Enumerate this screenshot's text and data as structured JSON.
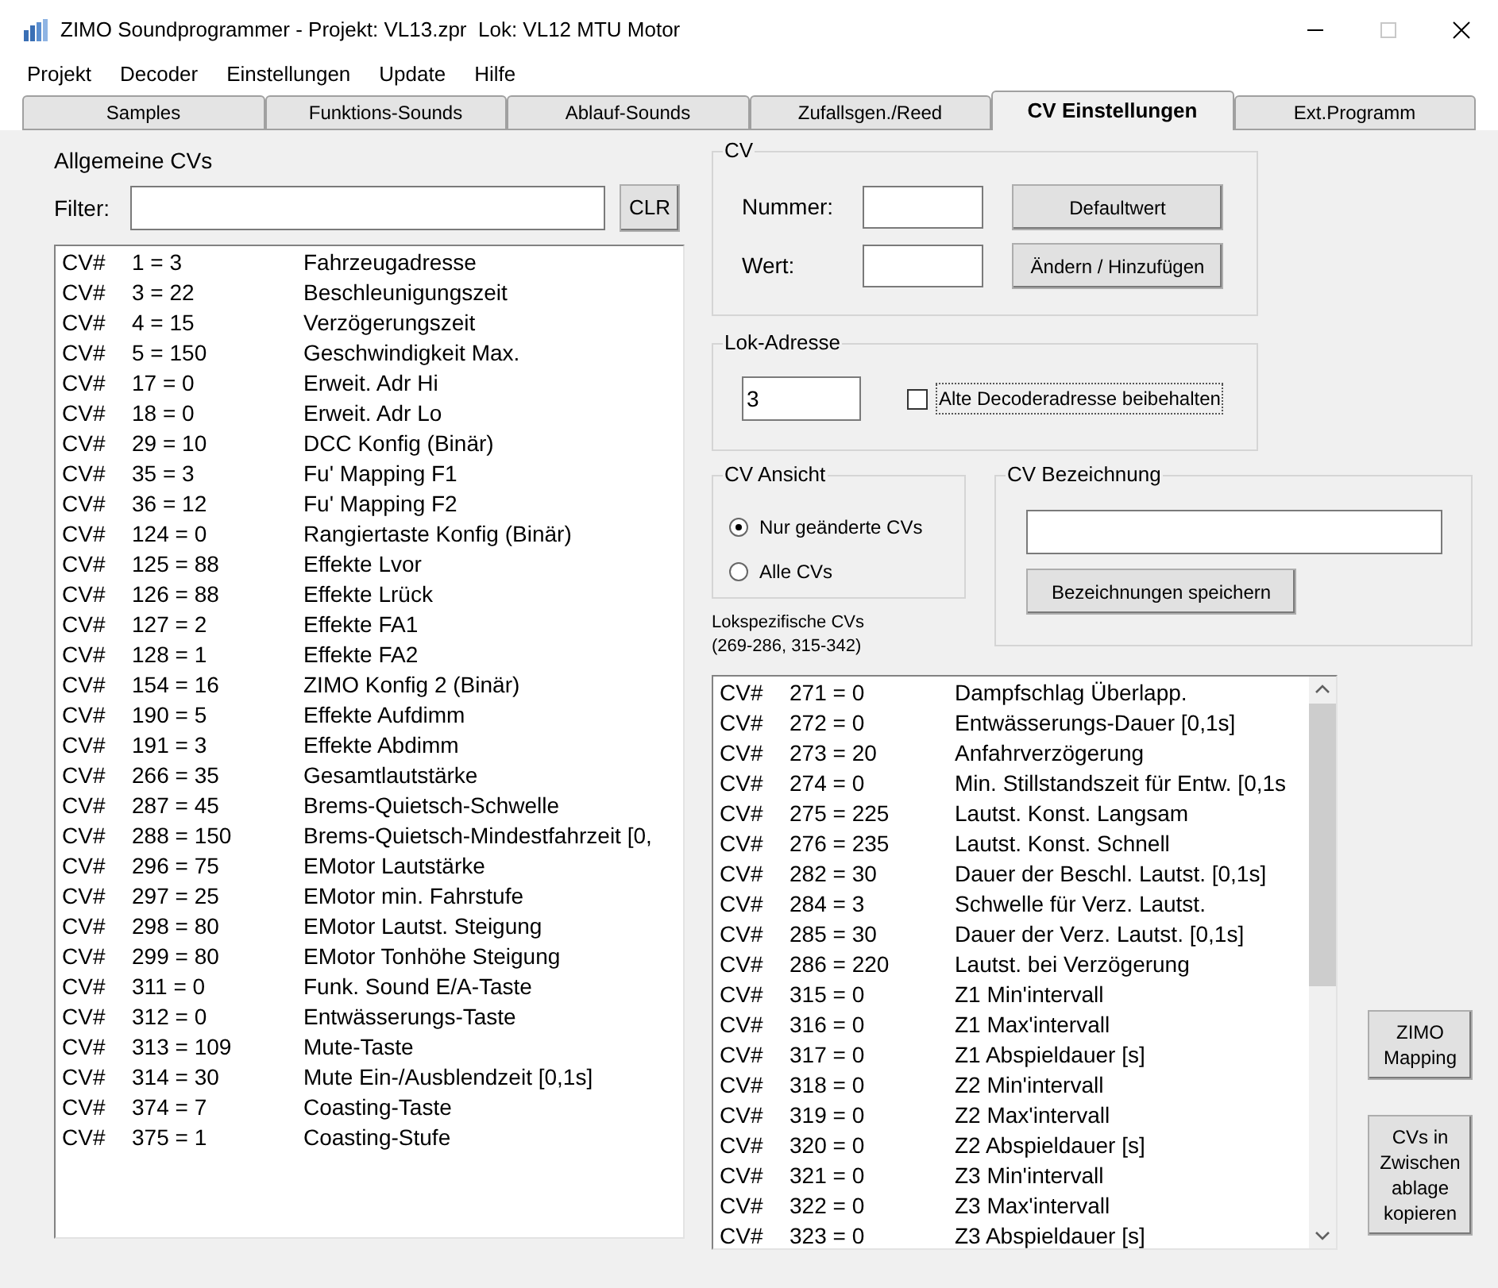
{
  "window": {
    "title": "ZIMO Soundprogrammer - Projekt: VL13.zpr  Lok: VL12 MTU Motor"
  },
  "menu": [
    "Projekt",
    "Decoder",
    "Einstellungen",
    "Update",
    "Hilfe"
  ],
  "tabs": [
    {
      "label": "Samples",
      "selected": false
    },
    {
      "label": "Funktions-Sounds",
      "selected": false
    },
    {
      "label": "Ablauf-Sounds",
      "selected": false
    },
    {
      "label": "Zufallsgen./Reed",
      "selected": false
    },
    {
      "label": "CV Einstellungen",
      "selected": true
    },
    {
      "label": "Ext.Programm",
      "selected": false
    }
  ],
  "general": {
    "title": "Allgemeine CVs",
    "filter_label": "Filter:",
    "clear_button": "CLR",
    "rows": [
      {
        "prefix": "CV#",
        "entry": "1 = 3",
        "description": "Fahrzeugadresse"
      },
      {
        "prefix": "CV#",
        "entry": "3 = 22",
        "description": "Beschleunigungszeit"
      },
      {
        "prefix": "CV#",
        "entry": "4 = 15",
        "description": "Verzögerungszeit"
      },
      {
        "prefix": "CV#",
        "entry": "5 = 150",
        "description": "Geschwindigkeit Max."
      },
      {
        "prefix": "CV#",
        "entry": "17 = 0",
        "description": "Erweit. Adr Hi"
      },
      {
        "prefix": "CV#",
        "entry": "18 = 0",
        "description": "Erweit. Adr Lo"
      },
      {
        "prefix": "CV#",
        "entry": "29 = 10",
        "description": "DCC Konfig (Binär)"
      },
      {
        "prefix": "CV#",
        "entry": "35 = 3",
        "description": "Fu' Mapping F1"
      },
      {
        "prefix": "CV#",
        "entry": "36 = 12",
        "description": "Fu' Mapping F2"
      },
      {
        "prefix": "CV#",
        "entry": "124 = 0",
        "description": "Rangiertaste Konfig  (Binär)"
      },
      {
        "prefix": "CV#",
        "entry": "125 = 88",
        "description": "Effekte Lvor"
      },
      {
        "prefix": "CV#",
        "entry": "126 = 88",
        "description": "Effekte Lrück"
      },
      {
        "prefix": "CV#",
        "entry": "127 = 2",
        "description": "Effekte FA1"
      },
      {
        "prefix": "CV#",
        "entry": "128 = 1",
        "description": "Effekte FA2"
      },
      {
        "prefix": "CV#",
        "entry": "154 = 16",
        "description": "ZIMO Konfig 2 (Binär)"
      },
      {
        "prefix": "CV#",
        "entry": "190 = 5",
        "description": "Effekte Aufdimm"
      },
      {
        "prefix": "CV#",
        "entry": "191 = 3",
        "description": "Effekte Abdimm"
      },
      {
        "prefix": "CV#",
        "entry": "266 = 35",
        "description": "Gesamtlautstärke"
      },
      {
        "prefix": "CV#",
        "entry": "287 = 45",
        "description": "Brems-Quietsch-Schwelle"
      },
      {
        "prefix": "CV#",
        "entry": "288 = 150",
        "description": "Brems-Quietsch-Mindestfahrzeit [0,"
      },
      {
        "prefix": "CV#",
        "entry": "296 = 75",
        "description": "EMotor Lautstärke"
      },
      {
        "prefix": "CV#",
        "entry": "297 = 25",
        "description": "EMotor min. Fahrstufe"
      },
      {
        "prefix": "CV#",
        "entry": "298 = 80",
        "description": "EMotor Lautst. Steigung"
      },
      {
        "prefix": "CV#",
        "entry": "299 = 80",
        "description": "EMotor Tonhöhe Steigung"
      },
      {
        "prefix": "CV#",
        "entry": "311 = 0",
        "description": "Funk. Sound E/A-Taste"
      },
      {
        "prefix": "CV#",
        "entry": "312 = 0",
        "description": "Entwässerungs-Taste"
      },
      {
        "prefix": "CV#",
        "entry": "313 = 109",
        "description": "Mute-Taste"
      },
      {
        "prefix": "CV#",
        "entry": "314 = 30",
        "description": "Mute Ein-/Ausblendzeit [0,1s]"
      },
      {
        "prefix": "CV#",
        "entry": "374 = 7",
        "description": "Coasting-Taste"
      },
      {
        "prefix": "CV#",
        "entry": "375 = 1",
        "description": "Coasting-Stufe"
      }
    ]
  },
  "cv_group": {
    "title": "CV",
    "number_label": "Nummer:",
    "value_label": "Wert:",
    "default_button": "Defaultwert",
    "change_button": "Ändern / Hinzufügen"
  },
  "address_group": {
    "title": "Lok-Adresse",
    "address": "3",
    "keep_old": {
      "label": "Alte Decoderadresse beibehalten",
      "checked": false
    }
  },
  "view_group": {
    "title": "CV Ansicht",
    "options": [
      {
        "label": "Nur geänderte CVs",
        "selected": true
      },
      {
        "label": "Alle CVs",
        "selected": false
      }
    ]
  },
  "name_group": {
    "title": "CV Bezeichnung",
    "save_button": "Bezeichnungen speichern"
  },
  "loco": {
    "title_lines": [
      "Lokspezifische CVs",
      "(269-286, 315-342)"
    ],
    "rows": [
      {
        "prefix": "CV#",
        "entry": "271 = 0",
        "description": "Dampfschlag Überlapp."
      },
      {
        "prefix": "CV#",
        "entry": "272 = 0",
        "description": "Entwässerungs-Dauer [0,1s]"
      },
      {
        "prefix": "CV#",
        "entry": "273 = 20",
        "description": "Anfahrverzögerung"
      },
      {
        "prefix": "CV#",
        "entry": "274 = 0",
        "description": "Min. Stillstandszeit für Entw. [0,1s"
      },
      {
        "prefix": "CV#",
        "entry": "275 = 225",
        "description": "Lautst. Konst. Langsam"
      },
      {
        "prefix": "CV#",
        "entry": "276 = 235",
        "description": "Lautst. Konst. Schnell"
      },
      {
        "prefix": "CV#",
        "entry": "282 = 30",
        "description": "Dauer der Beschl. Lautst. [0,1s]"
      },
      {
        "prefix": "CV#",
        "entry": "284 = 3",
        "description": "Schwelle für Verz. Lautst."
      },
      {
        "prefix": "CV#",
        "entry": "285 = 30",
        "description": "Dauer der Verz. Lautst. [0,1s]"
      },
      {
        "prefix": "CV#",
        "entry": "286 = 220",
        "description": "Lautst. bei Verzögerung"
      },
      {
        "prefix": "CV#",
        "entry": "315 = 0",
        "description": "Z1 Min'intervall"
      },
      {
        "prefix": "CV#",
        "entry": "316 = 0",
        "description": "Z1 Max'intervall"
      },
      {
        "prefix": "CV#",
        "entry": "317 = 0",
        "description": "Z1 Abspieldauer [s]"
      },
      {
        "prefix": "CV#",
        "entry": "318 = 0",
        "description": "Z2 Min'intervall"
      },
      {
        "prefix": "CV#",
        "entry": "319 = 0",
        "description": "Z2 Max'intervall"
      },
      {
        "prefix": "CV#",
        "entry": "320 = 0",
        "description": "Z2 Abspieldauer [s]"
      },
      {
        "prefix": "CV#",
        "entry": "321 = 0",
        "description": "Z3 Min'intervall"
      },
      {
        "prefix": "CV#",
        "entry": "322 = 0",
        "description": "Z3 Max'intervall"
      },
      {
        "prefix": "CV#",
        "entry": "323 = 0",
        "description": "Z3 Abspieldauer [s]"
      }
    ]
  },
  "side_buttons": [
    [
      "ZIMO",
      "Mapping"
    ],
    [
      "CVs in",
      "Zwischen",
      "ablage",
      "kopieren"
    ]
  ]
}
